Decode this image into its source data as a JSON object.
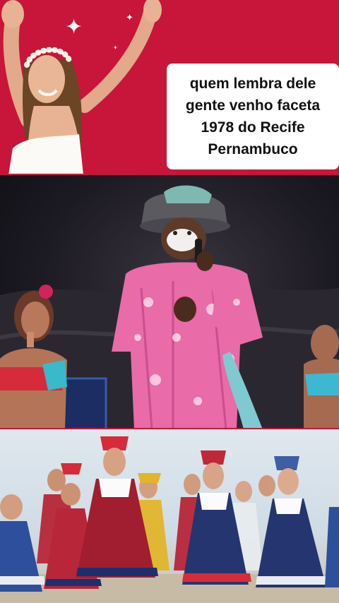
{
  "caption": {
    "lines": [
      "quem lembra dele",
      "gente venho faceta",
      "1978 do Recife",
      "Pernambuco"
    ]
  },
  "theme": {
    "top_background": "#c8153a",
    "caption_background": "#ffffff",
    "suit_pink": "#e96ba8"
  },
  "icons": {
    "sparkle_large": "✦",
    "sparkle_small": "✦"
  }
}
